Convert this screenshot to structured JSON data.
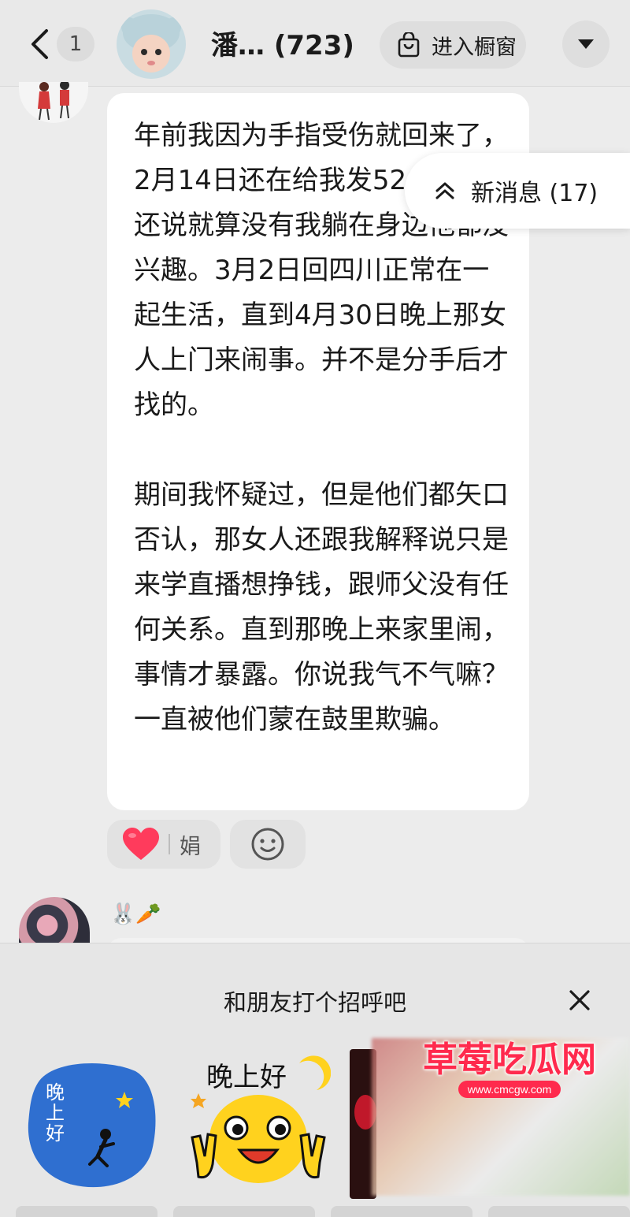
{
  "header": {
    "back_icon": "chevron-left-icon",
    "unread_count": "1",
    "title": "潘… (723)",
    "shop_label": "进入橱窗",
    "shop_icon": "shopping-bag-icon",
    "more_icon": "caret-down-icon"
  },
  "message": {
    "text": "年前我因为手指受伤就回来了，2月14日还在给我发520红包，还说就算没有我躺在身边他都没兴趣。3月2日回四川正常在一起生活，直到4月30日晚上那女人上门来闹事。并不是分手后才找的。\n\n期间我怀疑过，但是他们都矢口否认，那女人还跟我解释说只是来学直播想挣钱，跟师父没有任何关系。直到那晚上来家里闹，事情才暴露。你说我气不气嘛？一直被他们蒙在鼓里欺骗。",
    "reaction_icon": "heart-icon",
    "reaction_user": "娟",
    "add_reaction_icon": "smiley-icon"
  },
  "new_messages": {
    "label": "新消息 (17)",
    "icon": "double-chevron-up-icon"
  },
  "next_sender": {
    "name": "🐰🥕"
  },
  "greeting_panel": {
    "title": "和朋友打个招呼吧",
    "close_icon": "close-icon",
    "stickers": [
      {
        "name": "moon-sticker",
        "text": "晚上好"
      },
      {
        "name": "smiley-sticker",
        "text": "晚上好"
      }
    ]
  },
  "watermark": {
    "title": "草莓吃瓜网",
    "url": "www.cmcgw.com"
  },
  "colors": {
    "heart": "#ff3b5c",
    "watermark": "#ff2a4d",
    "sticker_blue": "#2f6fd0",
    "sticker_yellow": "#ffd21e"
  }
}
